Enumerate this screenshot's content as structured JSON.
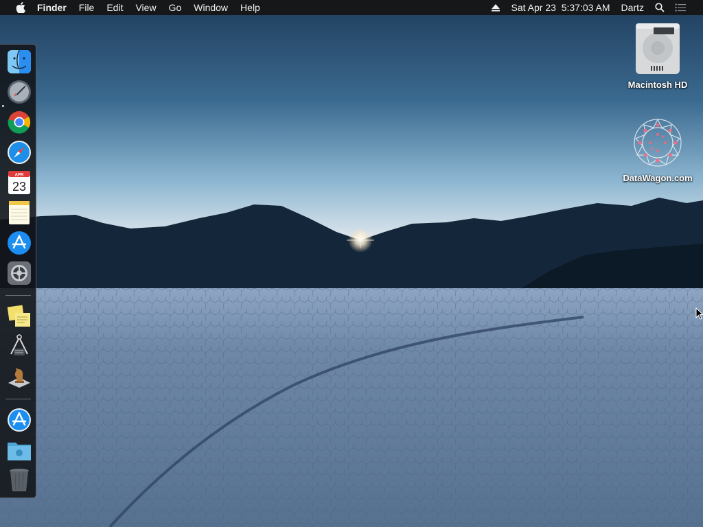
{
  "menubar": {
    "apple_icon": "apple-logo-icon",
    "app_name": "Finder",
    "menus": [
      "File",
      "Edit",
      "View",
      "Go",
      "Window",
      "Help"
    ],
    "eject_icon": "eject-icon",
    "clock": "Sat Apr 23  5:37:03 AM",
    "user": "Dartz",
    "spotlight_icon": "search-icon",
    "notifications_icon": "notification-center-icon"
  },
  "dock": {
    "apps": [
      {
        "name": "Finder",
        "icon": "finder-icon",
        "running": true
      },
      {
        "name": "Launchpad",
        "icon": "rocket-icon"
      },
      {
        "name": "Google Chrome",
        "icon": "chrome-icon"
      },
      {
        "name": "Safari",
        "icon": "compass-icon"
      },
      {
        "name": "Calendar",
        "icon": "calendar-icon",
        "month": "APR",
        "day": "23"
      },
      {
        "name": "Notes",
        "icon": "notepad-icon"
      },
      {
        "name": "App Store",
        "icon": "app-store-icon"
      },
      {
        "name": "System Preferences",
        "icon": "gear-icon"
      }
    ],
    "apps_group2": [
      {
        "name": "Stickies",
        "icon": "sticky-notes-icon"
      },
      {
        "name": "Instruments",
        "icon": "caliper-icon"
      },
      {
        "name": "Chess",
        "icon": "chess-knight-icon"
      }
    ],
    "stacks": [
      {
        "name": "App Store",
        "icon": "app-store-icon"
      },
      {
        "name": "Downloads",
        "icon": "folder-icon"
      },
      {
        "name": "Trash",
        "icon": "trash-icon"
      }
    ]
  },
  "desktop": {
    "icons": [
      {
        "label": "Macintosh HD",
        "icon": "hard-drive-icon"
      },
      {
        "label": "DataWagon.com",
        "icon": "network-volume-icon"
      }
    ]
  },
  "colors": {
    "menubar_bg": "#151719",
    "sky_top": "#1f3d5c",
    "sky_horizon": "#f3dde0",
    "mountains": "#14273a",
    "playa": "#6f88a8"
  }
}
